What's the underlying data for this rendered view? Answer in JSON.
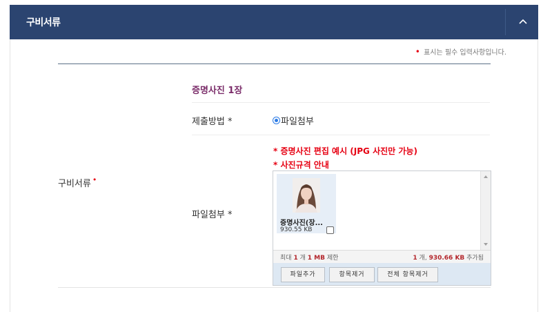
{
  "header": {
    "title": "구비서류"
  },
  "required_note": {
    "marker": "•",
    "text": "표시는 필수 입력사항입니다."
  },
  "row": {
    "label": "구비서류",
    "required_marker": "•"
  },
  "section": {
    "title": "증명사진 1장"
  },
  "submit_method": {
    "label": "제출방법 *",
    "option": "파일첨부",
    "selected": true
  },
  "links": {
    "edit_example": "* 증명사진 편집 예시 (JPG 사진만 가능)",
    "photo_guide": "* 사진규격 안내"
  },
  "attach": {
    "label": "파일첨부 *",
    "file": {
      "name": "증명사진(장...",
      "size": "930.55 KB",
      "checked": false
    },
    "limit": {
      "prefix": "최대",
      "count": "1",
      "count_unit": "개",
      "size": "1 MB",
      "suffix": "제한"
    },
    "status": {
      "count": "1",
      "count_unit": "개,",
      "size": "930.66 KB",
      "suffix": "추가됨"
    },
    "buttons": {
      "add": "파일추가",
      "remove": "항목제거",
      "remove_all": "전체 항목제거"
    }
  },
  "colors": {
    "header_bg": "#2b4470",
    "required": "#e60012",
    "section_title": "#7b2d6a",
    "link": "#e60012"
  },
  "icons": {
    "collapse": "chevron-up-icon"
  }
}
